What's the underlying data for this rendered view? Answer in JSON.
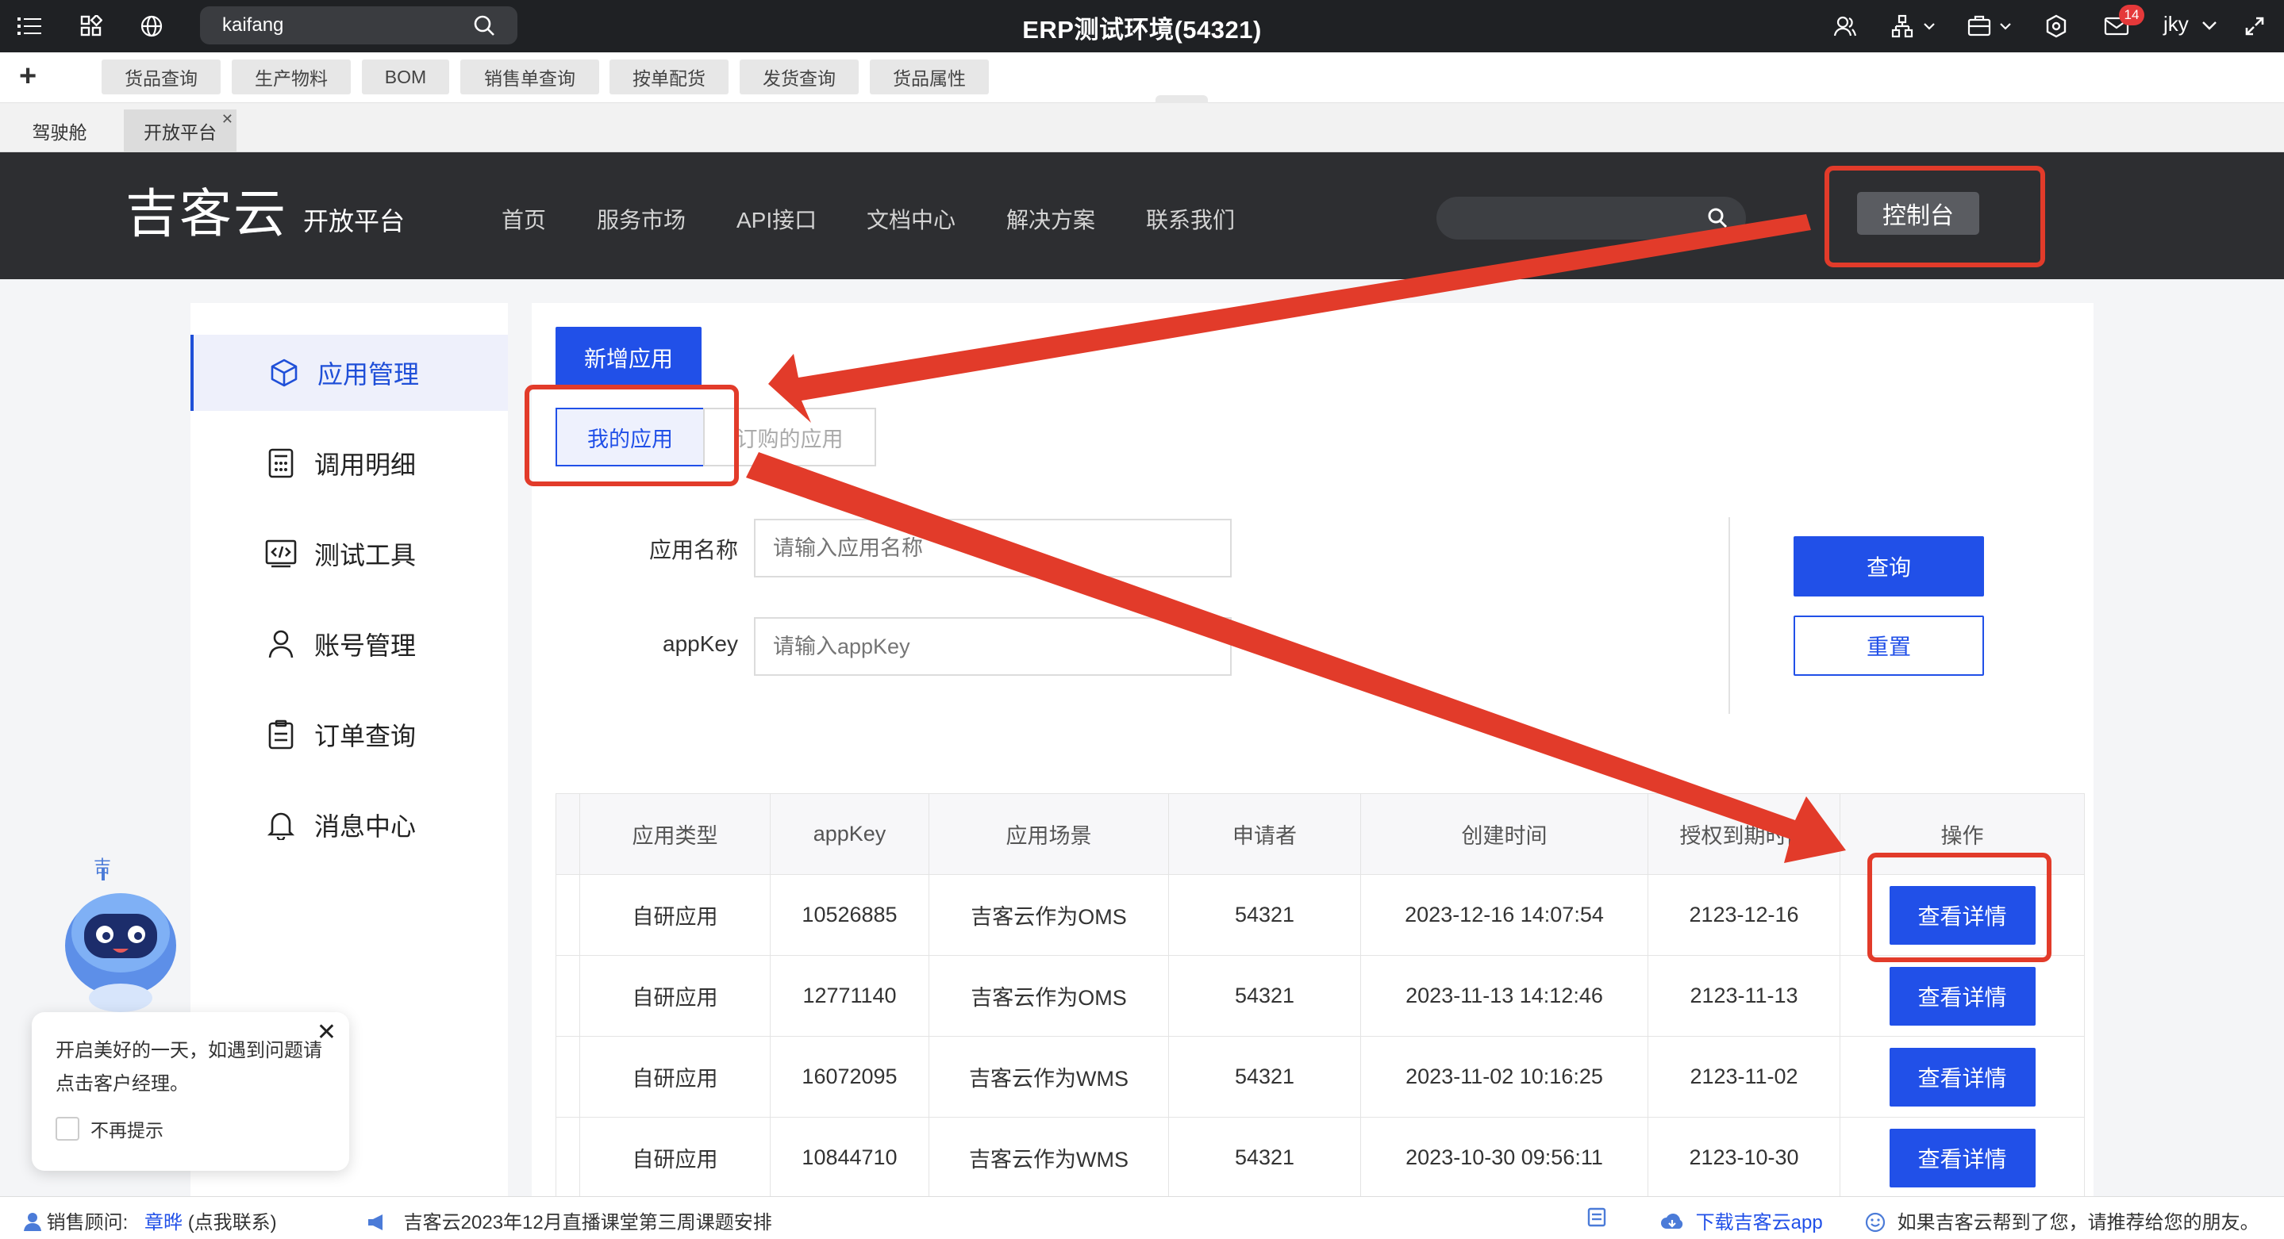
{
  "sysbar": {
    "search_value": "kaifang",
    "title": "ERP测试环境(54321)",
    "mail_badge": "14",
    "user": "jky"
  },
  "quick_links": [
    "货品查询",
    "生产物料",
    "BOM",
    "销售单查询",
    "按单配货",
    "发货查询",
    "货品属性"
  ],
  "page_tabs": [
    "驾驶舱",
    "开放平台"
  ],
  "portal": {
    "logo": "吉客云",
    "logo_sub": "开放平台",
    "nav": [
      "首页",
      "服务市场",
      "API接口",
      "文档中心",
      "解决方案",
      "联系我们"
    ],
    "console": "控制台"
  },
  "sidebar": {
    "items": [
      {
        "label": "应用管理",
        "icon": "cube-icon"
      },
      {
        "label": "调用明细",
        "icon": "calculator-icon"
      },
      {
        "label": "测试工具",
        "icon": "code-window-icon"
      },
      {
        "label": "账号管理",
        "icon": "person-icon"
      },
      {
        "label": "订单查询",
        "icon": "clipboard-icon"
      },
      {
        "label": "消息中心",
        "icon": "bell-icon"
      }
    ]
  },
  "main": {
    "add_app": "新增应用",
    "seg_my": "我的应用",
    "seg_ordered": "订购的应用",
    "app_name_label": "应用名称",
    "app_name_placeholder": "请输入应用名称",
    "appkey_label": "appKey",
    "appkey_placeholder": "请输入appKey",
    "query": "查询",
    "reset": "重置"
  },
  "table": {
    "headers": [
      "应用类型",
      "appKey",
      "应用场景",
      "申请者",
      "创建时间",
      "授权到期时间",
      "操作"
    ],
    "action_label": "查看详情",
    "rows": [
      [
        "自研应用",
        "10526885",
        "吉客云作为OMS",
        "54321",
        "2023-12-16 14:07:54",
        "2123-12-16"
      ],
      [
        "自研应用",
        "12771140",
        "吉客云作为OMS",
        "54321",
        "2023-11-13 14:12:46",
        "2123-11-13"
      ],
      [
        "自研应用",
        "16072095",
        "吉客云作为WMS",
        "54321",
        "2023-11-02 10:16:25",
        "2123-11-02"
      ],
      [
        "自研应用",
        "10844710",
        "吉客云作为WMS",
        "54321",
        "2023-10-30 09:56:11",
        "2123-10-30"
      ]
    ]
  },
  "tip": {
    "message": "开启美好的一天，如遇到问题请点击客户经理。",
    "checkbox": "不再提示"
  },
  "statusbar": {
    "advisor_label": "销售顾问:",
    "advisor_name": "章晔",
    "advisor_hint": "(点我联系)",
    "announcement": "吉客云2023年12月直播课堂第三周课题安排",
    "download": "下载吉客云app",
    "recommend": "如果吉客云帮到了您，请推荐给您的朋友。"
  },
  "colors": {
    "primary": "#2150e8",
    "annotation": "#e23b2a",
    "header_bg": "#2d2e31"
  }
}
